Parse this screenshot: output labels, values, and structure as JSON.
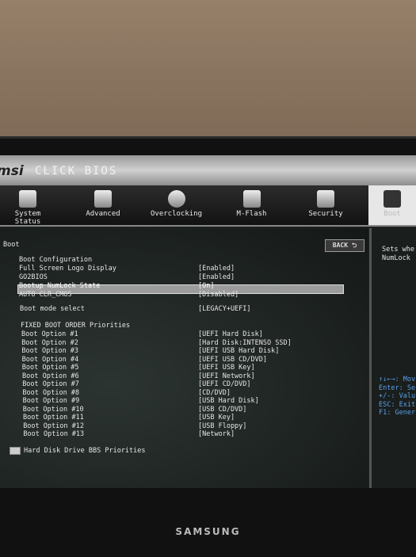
{
  "header": {
    "logo": "msi",
    "product": "CLICK BIOS"
  },
  "tabs": [
    {
      "label": "System Status",
      "icon": "monitor-icon"
    },
    {
      "label": "Advanced",
      "icon": "sliders-icon"
    },
    {
      "label": "Overclocking",
      "icon": "gauge-icon"
    },
    {
      "label": "M-Flash",
      "icon": "usb-bios-icon"
    },
    {
      "label": "Security",
      "icon": "lock-icon"
    },
    {
      "label": "Boot",
      "icon": "boot-icon",
      "active": true
    }
  ],
  "page": {
    "title": "Boot",
    "back_label": "BACK ⮌"
  },
  "config": {
    "heading": "Boot Configuration",
    "items": [
      {
        "label": "Full Screen Logo Display",
        "value": "[Enabled]"
      },
      {
        "label": "GO2BIOS",
        "value": "[Enabled]"
      },
      {
        "label": "Bootup NumLock State",
        "value": "[On]",
        "selected": true
      },
      {
        "label": "AUTO CLR_CMOS",
        "value": "[Disabled]"
      }
    ],
    "boot_mode": {
      "label": "Boot mode select",
      "value": "[LEGACY+UEFI]"
    }
  },
  "fixed": {
    "heading": "FIXED BOOT ORDER Priorities",
    "items": [
      {
        "label": "Boot Option #1",
        "value": "[UEFI Hard Disk]"
      },
      {
        "label": "Boot Option #2",
        "value": "[Hard Disk:INTENSO SSD]"
      },
      {
        "label": "Boot Option #3",
        "value": "[UEFI USB Hard Disk]"
      },
      {
        "label": "Boot Option #4",
        "value": "[UEFI USB CD/DVD]"
      },
      {
        "label": "Boot Option #5",
        "value": "[UEFI USB Key]"
      },
      {
        "label": "Boot Option #6",
        "value": "[UEFI Network]"
      },
      {
        "label": "Boot Option #7",
        "value": "[UEFI CD/DVD]"
      },
      {
        "label": "Boot Option #8",
        "value": "[CD/DVD]"
      },
      {
        "label": "Boot Option #9",
        "value": "[USB Hard Disk]"
      },
      {
        "label": "Boot Option #10",
        "value": "[USB CD/DVD]"
      },
      {
        "label": "Boot Option #11",
        "value": "[USB Key]"
      },
      {
        "label": "Boot Option #12",
        "value": "[USB Floppy]"
      },
      {
        "label": "Boot Option #13",
        "value": "[Network]"
      }
    ]
  },
  "submenu": "Hard Disk Drive BBS Priorities",
  "help": {
    "desc": [
      "Sets whe",
      "NumLock"
    ],
    "keys": [
      "↑↓←→: Mov",
      "Enter: Se",
      "+/-: Valu",
      "ESC: Exit",
      "F1: Gener"
    ]
  },
  "monitor_brand": "SAMSUNG"
}
